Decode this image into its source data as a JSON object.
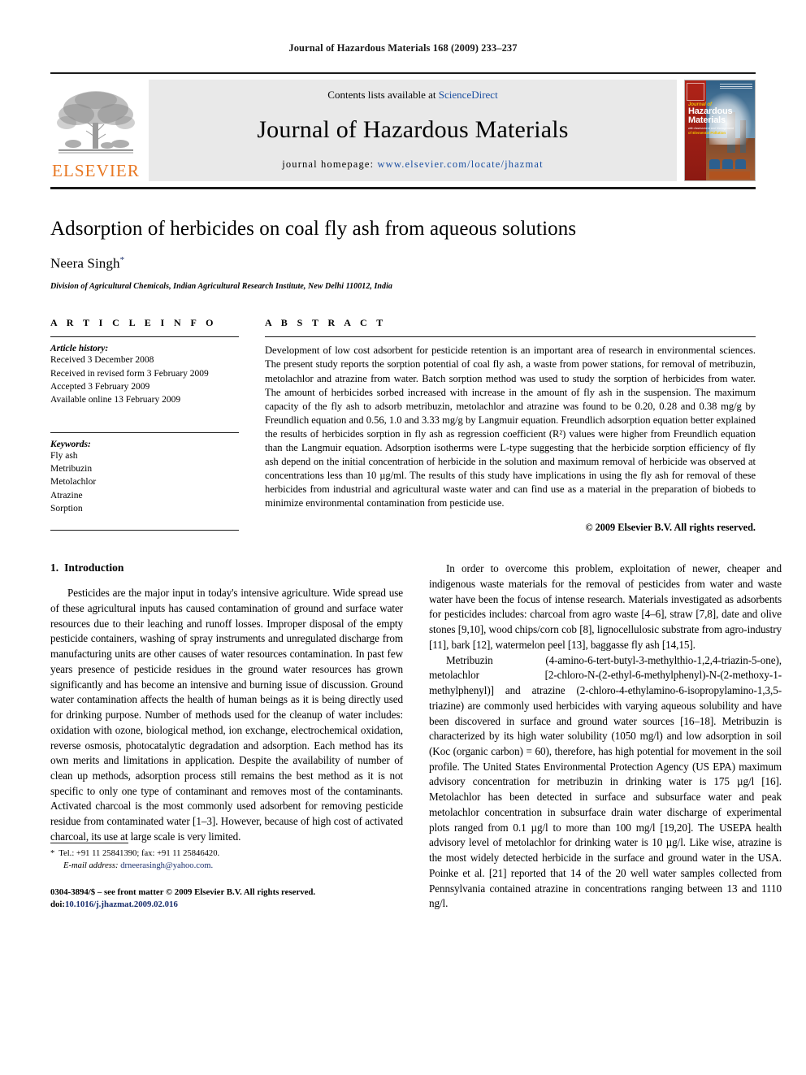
{
  "running_head": "Journal of Hazardous Materials 168 (2009) 233–237",
  "masthead": {
    "publisher_name": "ELSEVIER",
    "contents_prefix": "Contents lists available at ",
    "contents_link": "ScienceDirect",
    "journal_title": "Journal of Hazardous Materials",
    "homepage_prefix": "journal homepage: ",
    "homepage_url": "www.elsevier.com/locate/jhazmat",
    "cover": {
      "line1": "Journal of",
      "line2": "Hazardous",
      "line3": "Materials",
      "line4": "with Assessment and Management",
      "line5": "of Elemental Pollution"
    }
  },
  "article": {
    "title": "Adsorption of herbicides on coal fly ash from aqueous solutions",
    "author": "Neera Singh",
    "author_marker": "*",
    "affiliation": "Division of Agricultural Chemicals, Indian Agricultural Research Institute, New Delhi 110012, India"
  },
  "article_info": {
    "heading": "A R T I C L E   I N F O",
    "history_label": "Article history:",
    "history": [
      "Received 3 December 2008",
      "Received in revised form 3 February 2009",
      "Accepted 3 February 2009",
      "Available online 13 February 2009"
    ],
    "keywords_label": "Keywords:",
    "keywords": [
      "Fly ash",
      "Metribuzin",
      "Metolachlor",
      "Atrazine",
      "Sorption"
    ]
  },
  "abstract": {
    "heading": "A B S T R A C T",
    "text": "Development of low cost adsorbent for pesticide retention is an important area of research in environmental sciences. The present study reports the sorption potential of coal fly ash, a waste from power stations, for removal of metribuzin, metolachlor and atrazine from water. Batch sorption method was used to study the sorption of herbicides from water. The amount of herbicides sorbed increased with increase in the amount of fly ash in the suspension. The maximum capacity of the fly ash to adsorb metribuzin, metolachlor and atrazine was found to be 0.20, 0.28 and 0.38 mg/g by Freundlich equation and 0.56, 1.0 and 3.33 mg/g by Langmuir equation. Freundlich adsorption equation better explained the results of herbicides sorption in fly ash as regression coefficient (R²) values were higher from Freundlich equation than the Langmuir equation. Adsorption isotherms were L-type suggesting that the herbicide sorption efficiency of fly ash depend on the initial concentration of herbicide in the solution and maximum removal of herbicide was observed at concentrations less than 10 µg/ml. The results of this study have implications in using the fly ash for removal of these herbicides from industrial and agricultural waste water and can find use as a material in the preparation of biobeds to minimize environmental contamination from pesticide use.",
    "copyright": "© 2009 Elsevier B.V. All rights reserved."
  },
  "introduction": {
    "number": "1.",
    "title": "Introduction",
    "para1": "Pesticides are the major input in today's intensive agriculture. Wide spread use of these agricultural inputs has caused contamination of ground and surface water resources due to their leaching and runoff losses. Improper disposal of the empty pesticide containers, washing of spray instruments and unregulated discharge from manufacturing units are other causes of water resources contamination. In past few years presence of pesticide residues in the ground water resources has grown significantly and has become an intensive and burning issue of discussion. Ground water contamination affects the health of human beings as it is being directly used for drinking purpose. Number of methods used for the cleanup of water includes: oxidation with ozone, biological method, ion exchange, electrochemical oxidation, reverse osmosis, photocatalytic degradation and adsorption. Each method has its own merits and limitations in application. Despite the availability of number of clean up methods, adsorption process still remains the best method as it is not specific to only one type of contaminant and removes most of the contaminants. Activated charcoal is the most commonly used adsorbent for removing pesticide residue from contaminated water [1–3]. However, because of high cost of activated charcoal, its use at large scale is very limited.",
    "para2": "In order to overcome this problem, exploitation of newer, cheaper and indigenous waste materials for the removal of pesticides from water and waste water have been the focus of intense research. Materials investigated as adsorbents for pesticides includes: charcoal from agro waste [4–6], straw [7,8], date and olive stones [9,10], wood chips/corn cob [8], lignocellulosic substrate from agro-industry [11], bark [12], watermelon peel [13], baggasse fly ash [14,15].",
    "para3": "Metribuzin (4-amino-6-tert-butyl-3-methylthio-1,2,4-triazin-5-one), metolachlor [2-chloro-N-(2-ethyl-6-methylphenyl)-N-(2-methoxy-1-methylphenyl)] and atrazine (2-chloro-4-ethylamino-6-isopropylamino-1,3,5-triazine) are commonly used herbicides with varying aqueous solubility and have been discovered in surface and ground water sources [16–18]. Metribuzin is characterized by its high water solubility (1050 mg/l) and low adsorption in soil (Koc (organic carbon) = 60), therefore, has high potential for movement in the soil profile. The United States Environmental Protection Agency (US EPA) maximum advisory concentration for metribuzin in drinking water is 175 µg/l [16]. Metolachlor has been detected in surface and subsurface water and peak metolachlor concentration in subsurface drain water discharge of experimental plots ranged from 0.1 µg/l to more than 100 mg/l [19,20]. The USEPA health advisory level of metolachlor for drinking water is 10 µg/l. Like wise, atrazine is the most widely detected herbicide in the surface and ground water in the USA. Poinke et al. [21] reported that 14 of the 20 well water samples collected from Pennsylvania contained atrazine in concentrations ranging between 13 and 1110 ng/l."
  },
  "footnote": {
    "marker": "*",
    "contact": "Tel.: +91 11 25841390; fax: +91 11 25846420.",
    "email_label": "E-mail address:",
    "email": "drneerasingh@yahoo.com."
  },
  "footer": {
    "issn_line": "0304-3894/$ – see front matter © 2009 Elsevier B.V. All rights reserved.",
    "doi_label": "doi:",
    "doi": "10.1016/j.jhazmat.2009.02.016"
  },
  "colors": {
    "elsevier_orange": "#E87722",
    "link_blue": "#1a4ea0",
    "reference_blue": "#1a2f6d",
    "band_gray": "#e9e9e9"
  }
}
